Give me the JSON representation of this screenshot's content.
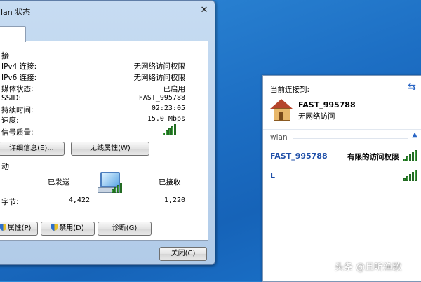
{
  "dialog": {
    "title": "lan 状态",
    "close_glyph": "✕",
    "connection": {
      "header": "接",
      "rows": [
        {
          "label": "IPv4 连接:",
          "value": "无网络访问权限"
        },
        {
          "label": "IPv6 连接:",
          "value": "无网络访问权限"
        },
        {
          "label": "媒体状态:",
          "value": "已启用"
        },
        {
          "label": "SSID:",
          "value": "FAST_995788"
        },
        {
          "label": "持续时间:",
          "value": "02:23:05"
        },
        {
          "label": "速度:",
          "value": "15.0 Mbps"
        }
      ],
      "signal_label": "信号质量:",
      "signal_level": 5,
      "details_button": "详细信息(E)...",
      "wireless_props_button": "无线属性(W)"
    },
    "activity": {
      "header": "动",
      "sent_label": "已发送",
      "received_label": "已接收",
      "bytes_label": "字节:",
      "sent_value": "4,422",
      "received_value": "1,220"
    },
    "buttons": {
      "properties": "属性(P)",
      "disable": "禁用(D)",
      "diagnose": "诊断(G)",
      "close": "关闭(C)"
    }
  },
  "flyout": {
    "header": "当前连接到:",
    "current": {
      "name": "FAST_995788",
      "status": "无网络访问"
    },
    "group": "wlan",
    "networks": [
      {
        "name": "FAST_995788",
        "status": "有限的访问权限",
        "signal_level": 5
      },
      {
        "name": "L",
        "status": "",
        "signal_level": 5
      }
    ]
  },
  "watermark": "头条 @且听渔歌",
  "colors": {
    "desktop": "#1d6fc4",
    "link_blue": "#1f4fa8",
    "signal_green": "#3aa23a"
  }
}
